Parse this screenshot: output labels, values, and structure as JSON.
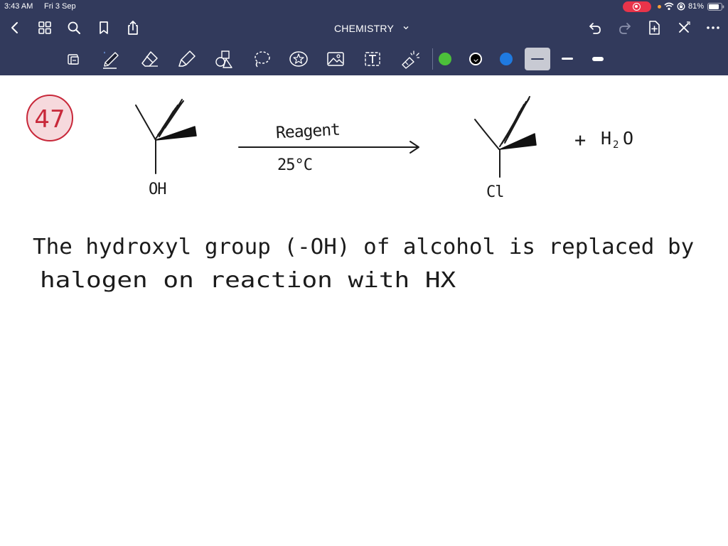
{
  "status_bar": {
    "time": "3:43 AM",
    "date": "Fri 3 Sep",
    "battery": "81%"
  },
  "nav": {
    "title": "CHEMISTRY"
  },
  "toolbar": {
    "tools": [
      "pages-icon",
      "pen-icon",
      "eraser-icon",
      "highlighter-icon",
      "shapes-icon",
      "lasso-icon",
      "sticker-icon",
      "image-icon",
      "text-box-icon",
      "laser-pointer-icon"
    ],
    "colors": {
      "green": "#4cc03a",
      "black": "#000000",
      "blue": "#1f7ae0",
      "chrome": "#323a5c"
    },
    "selected_color": "black",
    "selected_thickness": "thin"
  },
  "note": {
    "question_number": "47",
    "reactant_group": "OH",
    "arrow_top": "Reagent",
    "arrow_bottom": "25°C",
    "product_group": "Cl",
    "plus": "+",
    "byproduct_h": "H",
    "byproduct_sub": "2",
    "byproduct_o": "O",
    "explanation_line_1": "The hydroxyl group (-OH) of alcohol is replaced by",
    "explanation_line_2": "halogen on reaction with HX"
  }
}
